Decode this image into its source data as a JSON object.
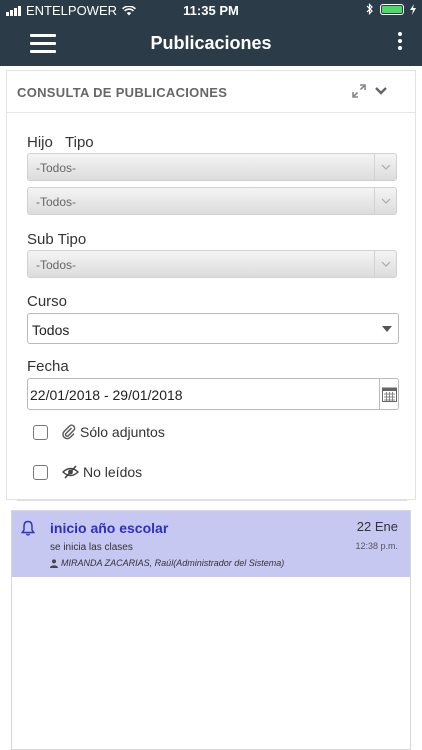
{
  "status_bar": {
    "carrier": "ENTELPOWER",
    "time": "11:35 PM"
  },
  "app_bar": {
    "title": "Publicaciones"
  },
  "panel": {
    "title": "CONSULTA DE PUBLICACIONES",
    "labels": {
      "hijo": "Hijo",
      "tipo": "Tipo",
      "sub_tipo": "Sub Tipo",
      "curso": "Curso",
      "fecha": "Fecha"
    },
    "hijo_select": "-Todos-",
    "tipo_select": "-Todos-",
    "sub_tipo_select": "-Todos-",
    "curso_select": "Todos",
    "fecha_value": "22/01/2018 - 29/01/2018",
    "solo_adjuntos": "Sólo adjuntos",
    "no_leidos": "No leídos"
  },
  "publications": [
    {
      "title": "inicio año escolar",
      "date": "22 Ene",
      "time": "12:38 p.m.",
      "summary": "se inicia las clases",
      "author": "MIRANDA ZACARIAS, Raúl(Administrador del Sistema)"
    }
  ],
  "colors": {
    "header_bg": "#2b3b48",
    "item_bg": "#c6c8f2",
    "item_title": "#2c2fc4",
    "battery": "#4cd964"
  }
}
